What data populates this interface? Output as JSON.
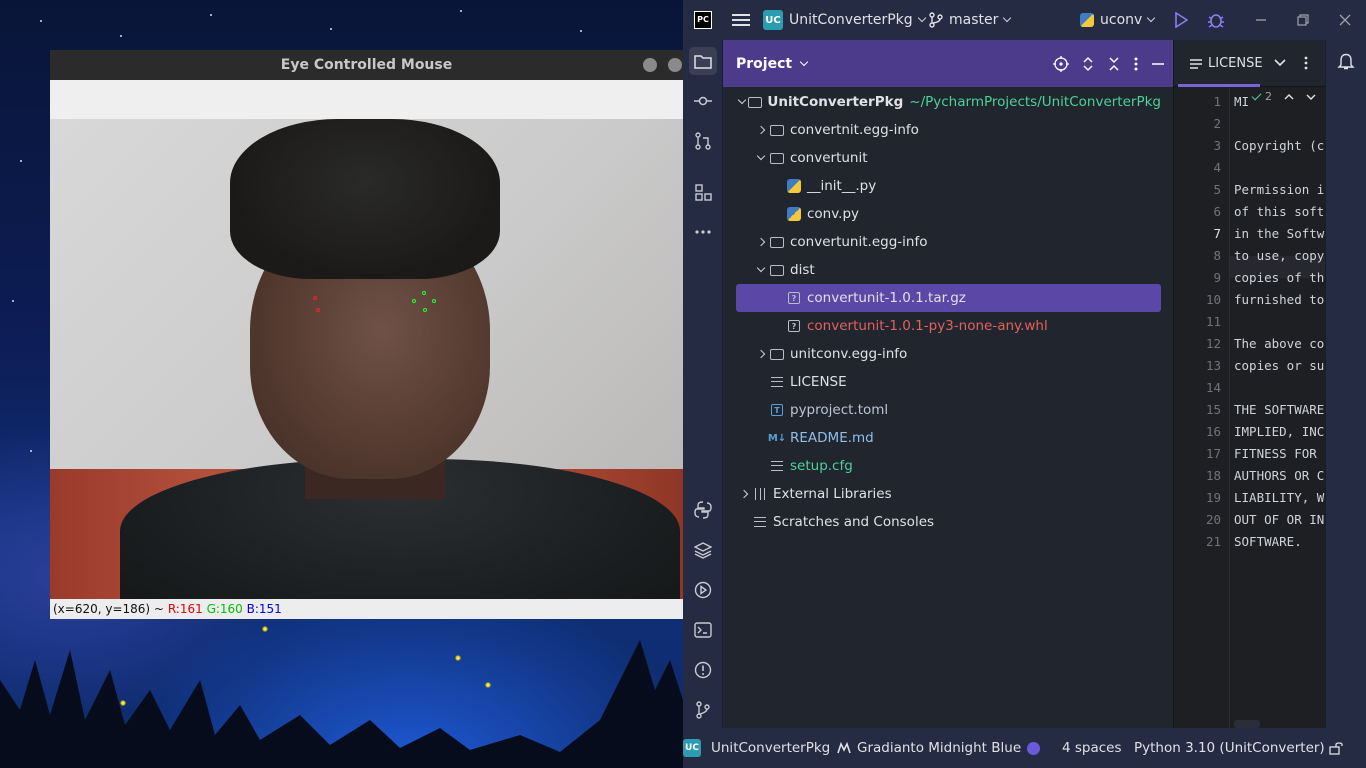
{
  "desktop": {
    "ecm_window": {
      "title": "Eye Controlled Mouse",
      "status": {
        "coords": "(x=620, y=186) ~",
        "r": "R:161",
        "g": "G:160",
        "b": "B:151",
        "colors": {
          "r": "#e00000",
          "g": "#00c000",
          "b": "#0000dd"
        }
      }
    }
  },
  "ide": {
    "header": {
      "project": "UnitConverterPkg",
      "project_badge": "UC",
      "branch": "master",
      "run_config": "uconv",
      "logo": "PC"
    },
    "project_panel": {
      "title": "Project",
      "tree": [
        {
          "label": "UnitConverterPkg",
          "path": "~/PycharmProjects/UnitConverterPkg",
          "depth": 0,
          "toggle": "open",
          "icon": "folder"
        },
        {
          "label": "convertnit.egg-info",
          "depth": 1,
          "toggle": "closed",
          "icon": "folder"
        },
        {
          "label": "convertunit",
          "depth": 1,
          "toggle": "open",
          "icon": "package"
        },
        {
          "label": "__init__.py",
          "depth": 2,
          "toggle": "none",
          "icon": "python"
        },
        {
          "label": "conv.py",
          "depth": 2,
          "toggle": "none",
          "icon": "python"
        },
        {
          "label": "convertunit.egg-info",
          "depth": 1,
          "toggle": "closed",
          "icon": "folder"
        },
        {
          "label": "dist",
          "depth": 1,
          "toggle": "open",
          "icon": "folder"
        },
        {
          "label": "convertunit-1.0.1.tar.gz",
          "depth": 2,
          "toggle": "none",
          "icon": "unknown",
          "selected": true
        },
        {
          "label": "convertunit-1.0.1-py3-none-any.whl",
          "depth": 2,
          "toggle": "none",
          "icon": "unknown",
          "color": "#e0625a"
        },
        {
          "label": "unitconv.egg-info",
          "depth": 1,
          "toggle": "closed",
          "icon": "folder"
        },
        {
          "label": "LICENSE",
          "depth": 1,
          "toggle": "none",
          "icon": "text"
        },
        {
          "label": "pyproject.toml",
          "depth": 1,
          "toggle": "none",
          "icon": "toml",
          "color": "#b9c5d6"
        },
        {
          "label": "README.md",
          "depth": 1,
          "toggle": "none",
          "icon": "markdown",
          "color": "#8fbfe8"
        },
        {
          "label": "setup.cfg",
          "depth": 1,
          "toggle": "none",
          "icon": "text",
          "color": "#4bd29a"
        },
        {
          "label": "External Libraries",
          "depth": 0,
          "toggle": "closed",
          "icon": "library"
        },
        {
          "label": "Scratches and Consoles",
          "depth": 0,
          "toggle": "none",
          "icon": "scratch"
        }
      ]
    },
    "editor": {
      "tab_label": "LICENSE",
      "inspection_count": "2",
      "current_line": 7,
      "lines": [
        "MI",
        "",
        "Copyright (c",
        "",
        "Permission i",
        "of this soft",
        "in the Softw",
        "to use, copy",
        "copies of th",
        "furnished to",
        "",
        "The above co",
        "copies or su",
        "",
        "THE SOFTWARE",
        "IMPLIED, INC",
        "FITNESS FOR ",
        "AUTHORS OR C",
        "LIABILITY, W",
        "OUT OF OR IN",
        "SOFTWARE."
      ]
    },
    "statusbar": {
      "project_badge": "UC",
      "project": "UnitConverterPkg",
      "theme": "Gradianto Midnight Blue",
      "indent": "4 spaces",
      "interpreter": "Python 3.10 (UnitConverter)"
    }
  }
}
